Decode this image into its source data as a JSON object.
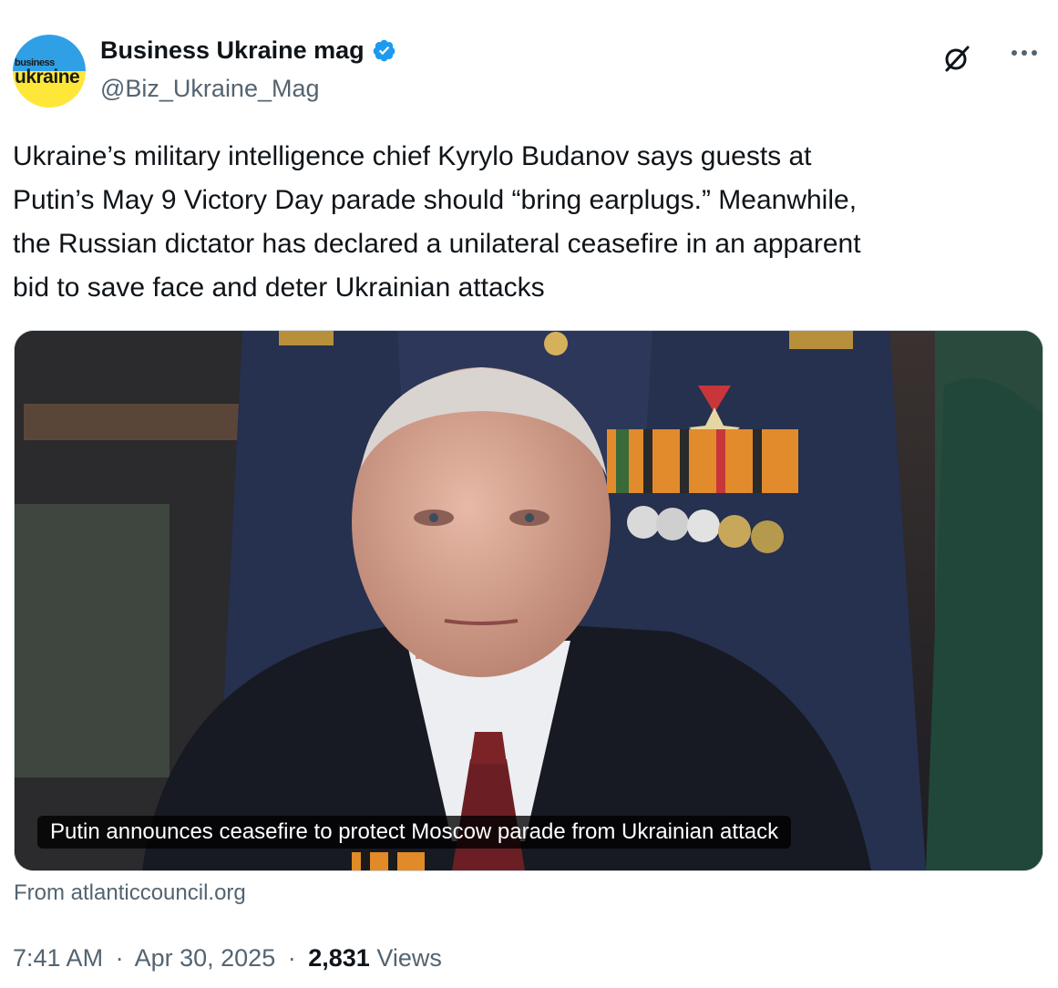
{
  "author": {
    "display_name": "Business Ukraine mag",
    "handle": "@Biz_Ukraine_Mag",
    "avatar_text_small": "business",
    "avatar_text_big": "ukraine",
    "verified_color": "#1d9bf0"
  },
  "tweet": {
    "text_lines": [
      "Ukraine’s military intelligence chief Kyrylo Budanov says guests at",
      "Putin’s May 9 Victory Day parade should “bring earplugs.” Meanwhile,",
      "the Russian dictator has declared a unilateral ceasefire in an apparent",
      "bid to save face and deter Ukrainian attacks"
    ]
  },
  "card": {
    "caption": "Putin announces ceasefire to protect Moscow parade from Ukrainian attack",
    "source": "From atlanticcouncil.org"
  },
  "meta": {
    "time": "7:41 AM",
    "date": "Apr 30, 2025",
    "separator": "·",
    "views_count": "2,831",
    "views_label": "Views"
  },
  "icons": {
    "grok": "grok-icon",
    "more": "more-icon",
    "verified": "verified-badge-icon"
  }
}
